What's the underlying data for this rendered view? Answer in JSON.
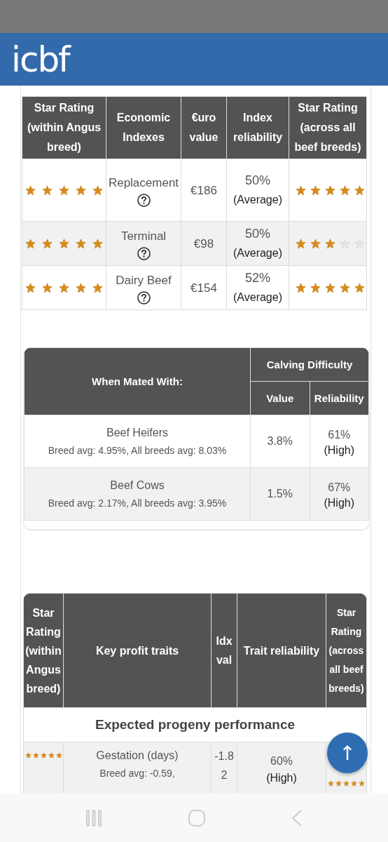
{
  "header": {
    "logo": "icbf"
  },
  "index_table": {
    "columns": [
      "Star Rating (within Angus breed)",
      "Economic Indexes",
      "€uro value",
      "Index reliability",
      "Star Rating (across all beef breeds)"
    ],
    "rows": [
      {
        "rating_within": {
          "stars": 5
        },
        "index": "Replacement",
        "value": "€186",
        "reliability": "50%",
        "reliability_label": "(Average)",
        "rating_across": {
          "stars": 5
        }
      },
      {
        "rating_within": {
          "stars": 5
        },
        "index": "Terminal",
        "value": "€98",
        "reliability": "50%",
        "reliability_label": "(Average)",
        "rating_across": {
          "stars": 3
        }
      },
      {
        "rating_within": {
          "stars": 5
        },
        "index": "Dairy Beef",
        "value": "€154",
        "reliability": "52%",
        "reliability_label": "(Average)",
        "rating_across": {
          "stars": 5
        }
      }
    ]
  },
  "calving_table": {
    "mated_heading": "When Mated With:",
    "group_heading": "Calving Difficulty",
    "columns": [
      "Value",
      "Reliability"
    ],
    "rows": [
      {
        "name": "Beef Heifers",
        "note": "Breed avg: 4.95%, All breeds avg: 8.03%",
        "value": "3.8%",
        "reliability": "61%",
        "reliability_label": "(High)"
      },
      {
        "name": "Beef Cows",
        "note": "Breed avg: 2.17%, All breeds avg: 3.95%",
        "value": "1.5%",
        "reliability": "67%",
        "reliability_label": "(High)"
      }
    ]
  },
  "traits_table": {
    "columns": [
      "Star Rating (within Angus breed)",
      "Key profit traits",
      "Idx val",
      "Trait reliability",
      "Star Rating (across all beef breeds)"
    ],
    "section": "Expected progeny performance",
    "rows": [
      {
        "rating_within": {
          "stars": 5
        },
        "trait": "Gestation (days)",
        "note": "Breed avg: -0.59,",
        "value": "-1.82",
        "reliability": "60%",
        "reliability_label": "(High)",
        "rating_across": {
          "stars": 5
        }
      }
    ]
  },
  "scroll_top_button": "↑"
}
